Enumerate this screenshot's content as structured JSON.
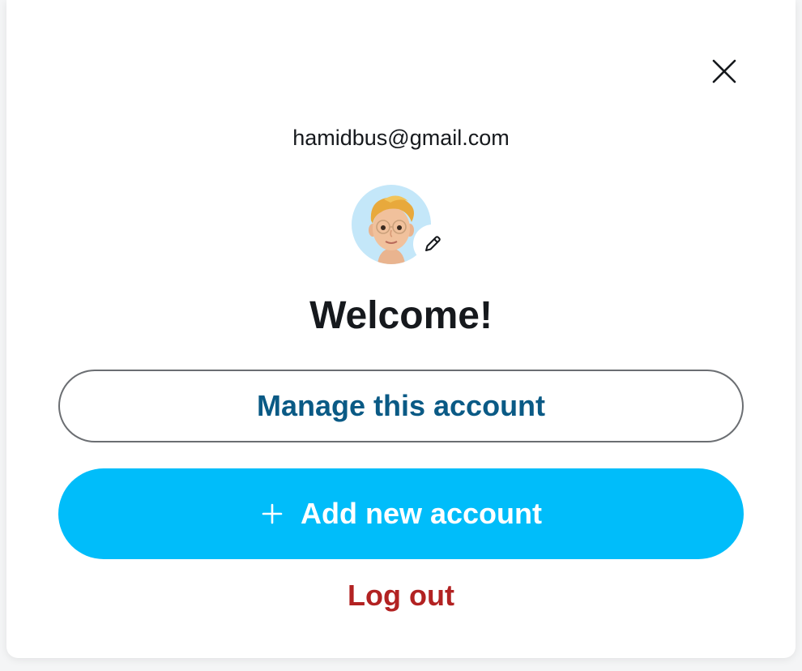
{
  "account_dialog": {
    "email": "hamidbus@gmail.com",
    "greeting": "Welcome!",
    "manage_label": "Manage this account",
    "add_label": "Add new account",
    "logout_label": "Log out",
    "icons": {
      "close": "close-icon",
      "edit": "pencil-icon",
      "add": "plus-icon",
      "avatar": "memoji-avatar"
    },
    "colors": {
      "primary": "#00bdfa",
      "link": "#0a5a85",
      "danger": "#b22222",
      "avatar_bg": "#c4e7f9"
    }
  }
}
